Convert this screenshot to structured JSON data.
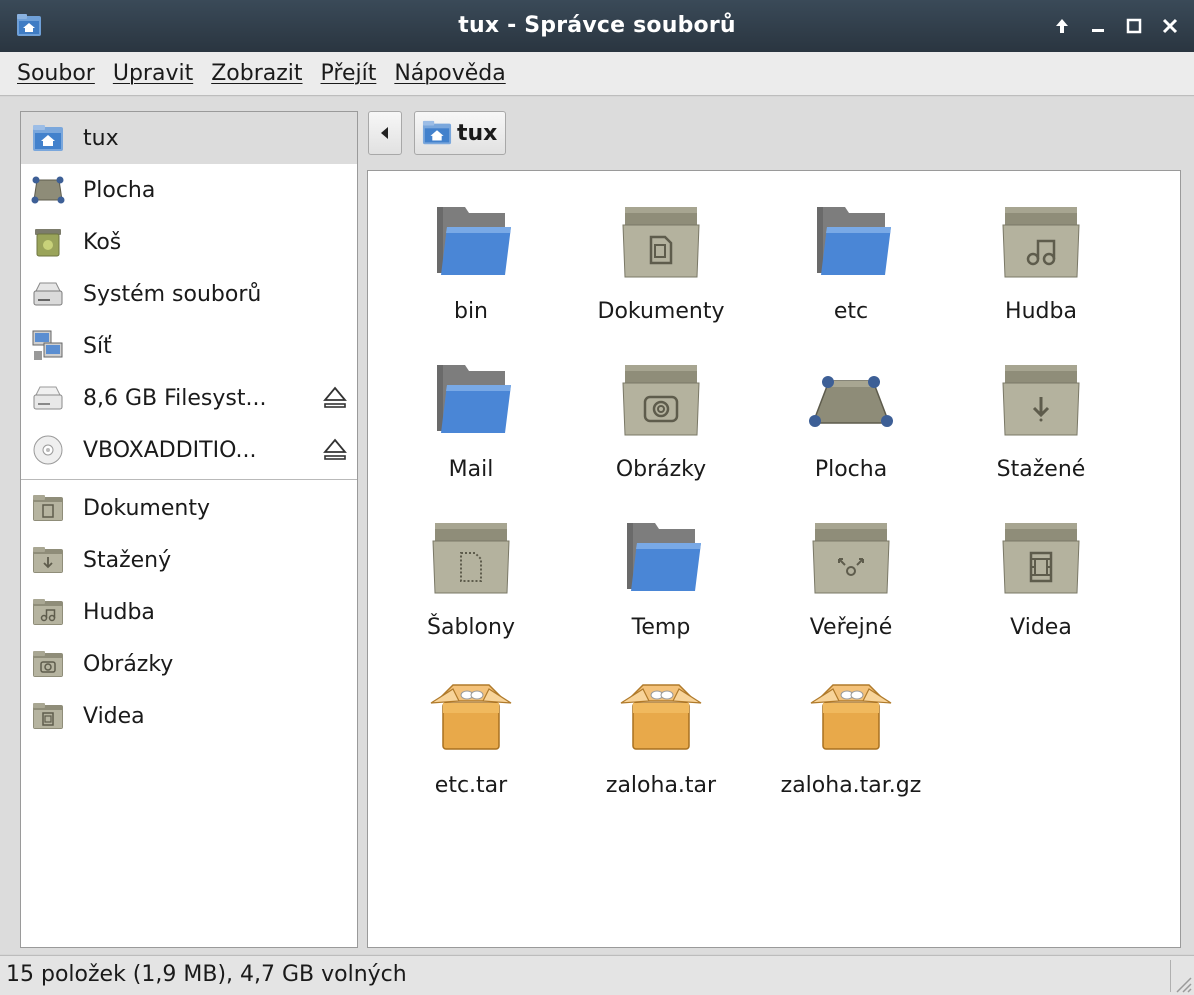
{
  "window": {
    "title": "tux - Správce souborů",
    "buttons": [
      "↑",
      "–",
      "□",
      "✕"
    ]
  },
  "menubar": {
    "items": [
      {
        "label": "Soubor"
      },
      {
        "label": "Upravit"
      },
      {
        "label": "Zobrazit"
      },
      {
        "label": "Přejít"
      },
      {
        "label": "Nápověda"
      }
    ]
  },
  "sidebar": {
    "devices": [
      {
        "label": "tux",
        "icon": "home-folder-icon",
        "selected": true
      },
      {
        "label": "Plocha",
        "icon": "desktop-icon"
      },
      {
        "label": "Koš",
        "icon": "trash-icon"
      },
      {
        "label": "Systém souborů",
        "icon": "filesystem-drive-icon"
      },
      {
        "label": "Síť",
        "icon": "network-icon"
      },
      {
        "label": "8,6 GB Filesyst...",
        "icon": "drive-icon",
        "eject": true
      },
      {
        "label": "VBOXADDITIO...",
        "icon": "cdrom-icon",
        "eject": true
      }
    ],
    "places": [
      {
        "label": "Dokumenty",
        "icon": "documents-folder-icon"
      },
      {
        "label": "Stažený",
        "icon": "downloads-folder-icon"
      },
      {
        "label": "Hudba",
        "icon": "music-folder-icon"
      },
      {
        "label": "Obrázky",
        "icon": "pictures-folder-icon"
      },
      {
        "label": "Videa",
        "icon": "videos-folder-icon"
      }
    ]
  },
  "pathbar": {
    "back_icon": "back-arrow-icon",
    "crumb": "tux"
  },
  "files": [
    {
      "name": "bin",
      "icon": "folder-icon"
    },
    {
      "name": "Dokumenty",
      "icon": "documents-folder-icon"
    },
    {
      "name": "etc",
      "icon": "folder-icon"
    },
    {
      "name": "Hudba",
      "icon": "music-folder-icon"
    },
    {
      "name": "Mail",
      "icon": "folder-icon"
    },
    {
      "name": "Obrázky",
      "icon": "pictures-folder-icon"
    },
    {
      "name": "Plocha",
      "icon": "desktop-icon"
    },
    {
      "name": "Stažené",
      "icon": "downloads-folder-icon"
    },
    {
      "name": "Šablony",
      "icon": "templates-folder-icon"
    },
    {
      "name": "Temp",
      "icon": "folder-icon"
    },
    {
      "name": "Veřejné",
      "icon": "public-folder-icon"
    },
    {
      "name": "Videa",
      "icon": "videos-folder-icon"
    },
    {
      "name": "etc.tar",
      "icon": "archive-icon"
    },
    {
      "name": "zaloha.tar",
      "icon": "archive-icon"
    },
    {
      "name": "zaloha.tar.gz",
      "icon": "archive-icon"
    }
  ],
  "statusbar": {
    "text": "15 položek (1,9 MB), 4,7 GB volných"
  },
  "colors": {
    "titlebar": "#2f3b47",
    "folder_blue": "#4a86d6",
    "folder_gray": "#9a9886",
    "archive": "#e8a94a"
  }
}
